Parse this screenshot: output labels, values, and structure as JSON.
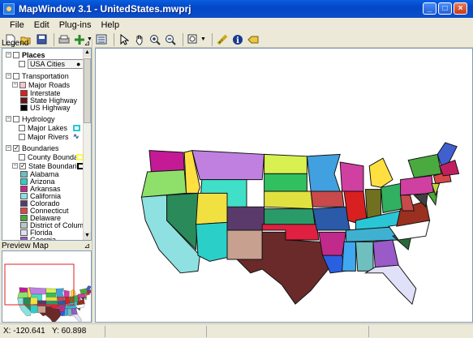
{
  "window": {
    "title": "MapWindow 3.1 - UnitedStates.mwprj"
  },
  "menu": [
    "File",
    "Edit",
    "Plug-ins",
    "Help"
  ],
  "toolbar": {
    "buttons": [
      "new-icon",
      "open-icon",
      "save-icon",
      "print-icon",
      "add-layer-icon",
      "properties-icon",
      "select-icon",
      "pan-icon",
      "zoom-in-icon",
      "zoom-out-icon",
      "zoom-extent-icon",
      "measure-icon",
      "identify-icon",
      "label-icon"
    ]
  },
  "legend": {
    "title": "Legend",
    "groups": [
      {
        "name": "Places",
        "layers": [
          {
            "name": "USA Cities",
            "symbol": "●"
          }
        ]
      },
      {
        "name": "Transportation",
        "layers": [
          {
            "name": "Major Roads",
            "categories": [
              {
                "label": "Interstate",
                "color": "#d92020"
              },
              {
                "label": "State Highway",
                "color": "#6b1414"
              },
              {
                "label": "US Highway",
                "color": "#000000"
              }
            ]
          }
        ]
      },
      {
        "name": "Hydrology",
        "layers": [
          {
            "name": "Major Lakes",
            "color": "#2ac6d6"
          },
          {
            "name": "Major Rivers",
            "symbol": "∿",
            "color": "#1a3a90"
          }
        ]
      },
      {
        "name": "Boundaries",
        "layers": [
          {
            "name": "County Boundar",
            "color": "#ffff40"
          },
          {
            "name": "State Boundarie",
            "color": "#000000",
            "categories": [
              {
                "label": "Alabama",
                "color": "#6fbfbf"
              },
              {
                "label": "Arizona",
                "color": "#2ad0c8"
              },
              {
                "label": "Arkansas",
                "color": "#c02a8a"
              },
              {
                "label": "California",
                "color": "#8fe0e0"
              },
              {
                "label": "Colorado",
                "color": "#5a3a6a"
              },
              {
                "label": "Connecticut",
                "color": "#d84848"
              },
              {
                "label": "Delaware",
                "color": "#48a838"
              },
              {
                "label": "District of Columbi",
                "color": "#b8c8c8"
              },
              {
                "label": "Florida",
                "color": "#e0e0f8"
              },
              {
                "label": "Georgia",
                "color": "#9a5ac8"
              }
            ]
          }
        ]
      }
    ]
  },
  "preview": {
    "title": "Preview Map"
  },
  "status": {
    "x": "X: -120.641",
    "y": "Y: 60.898"
  }
}
